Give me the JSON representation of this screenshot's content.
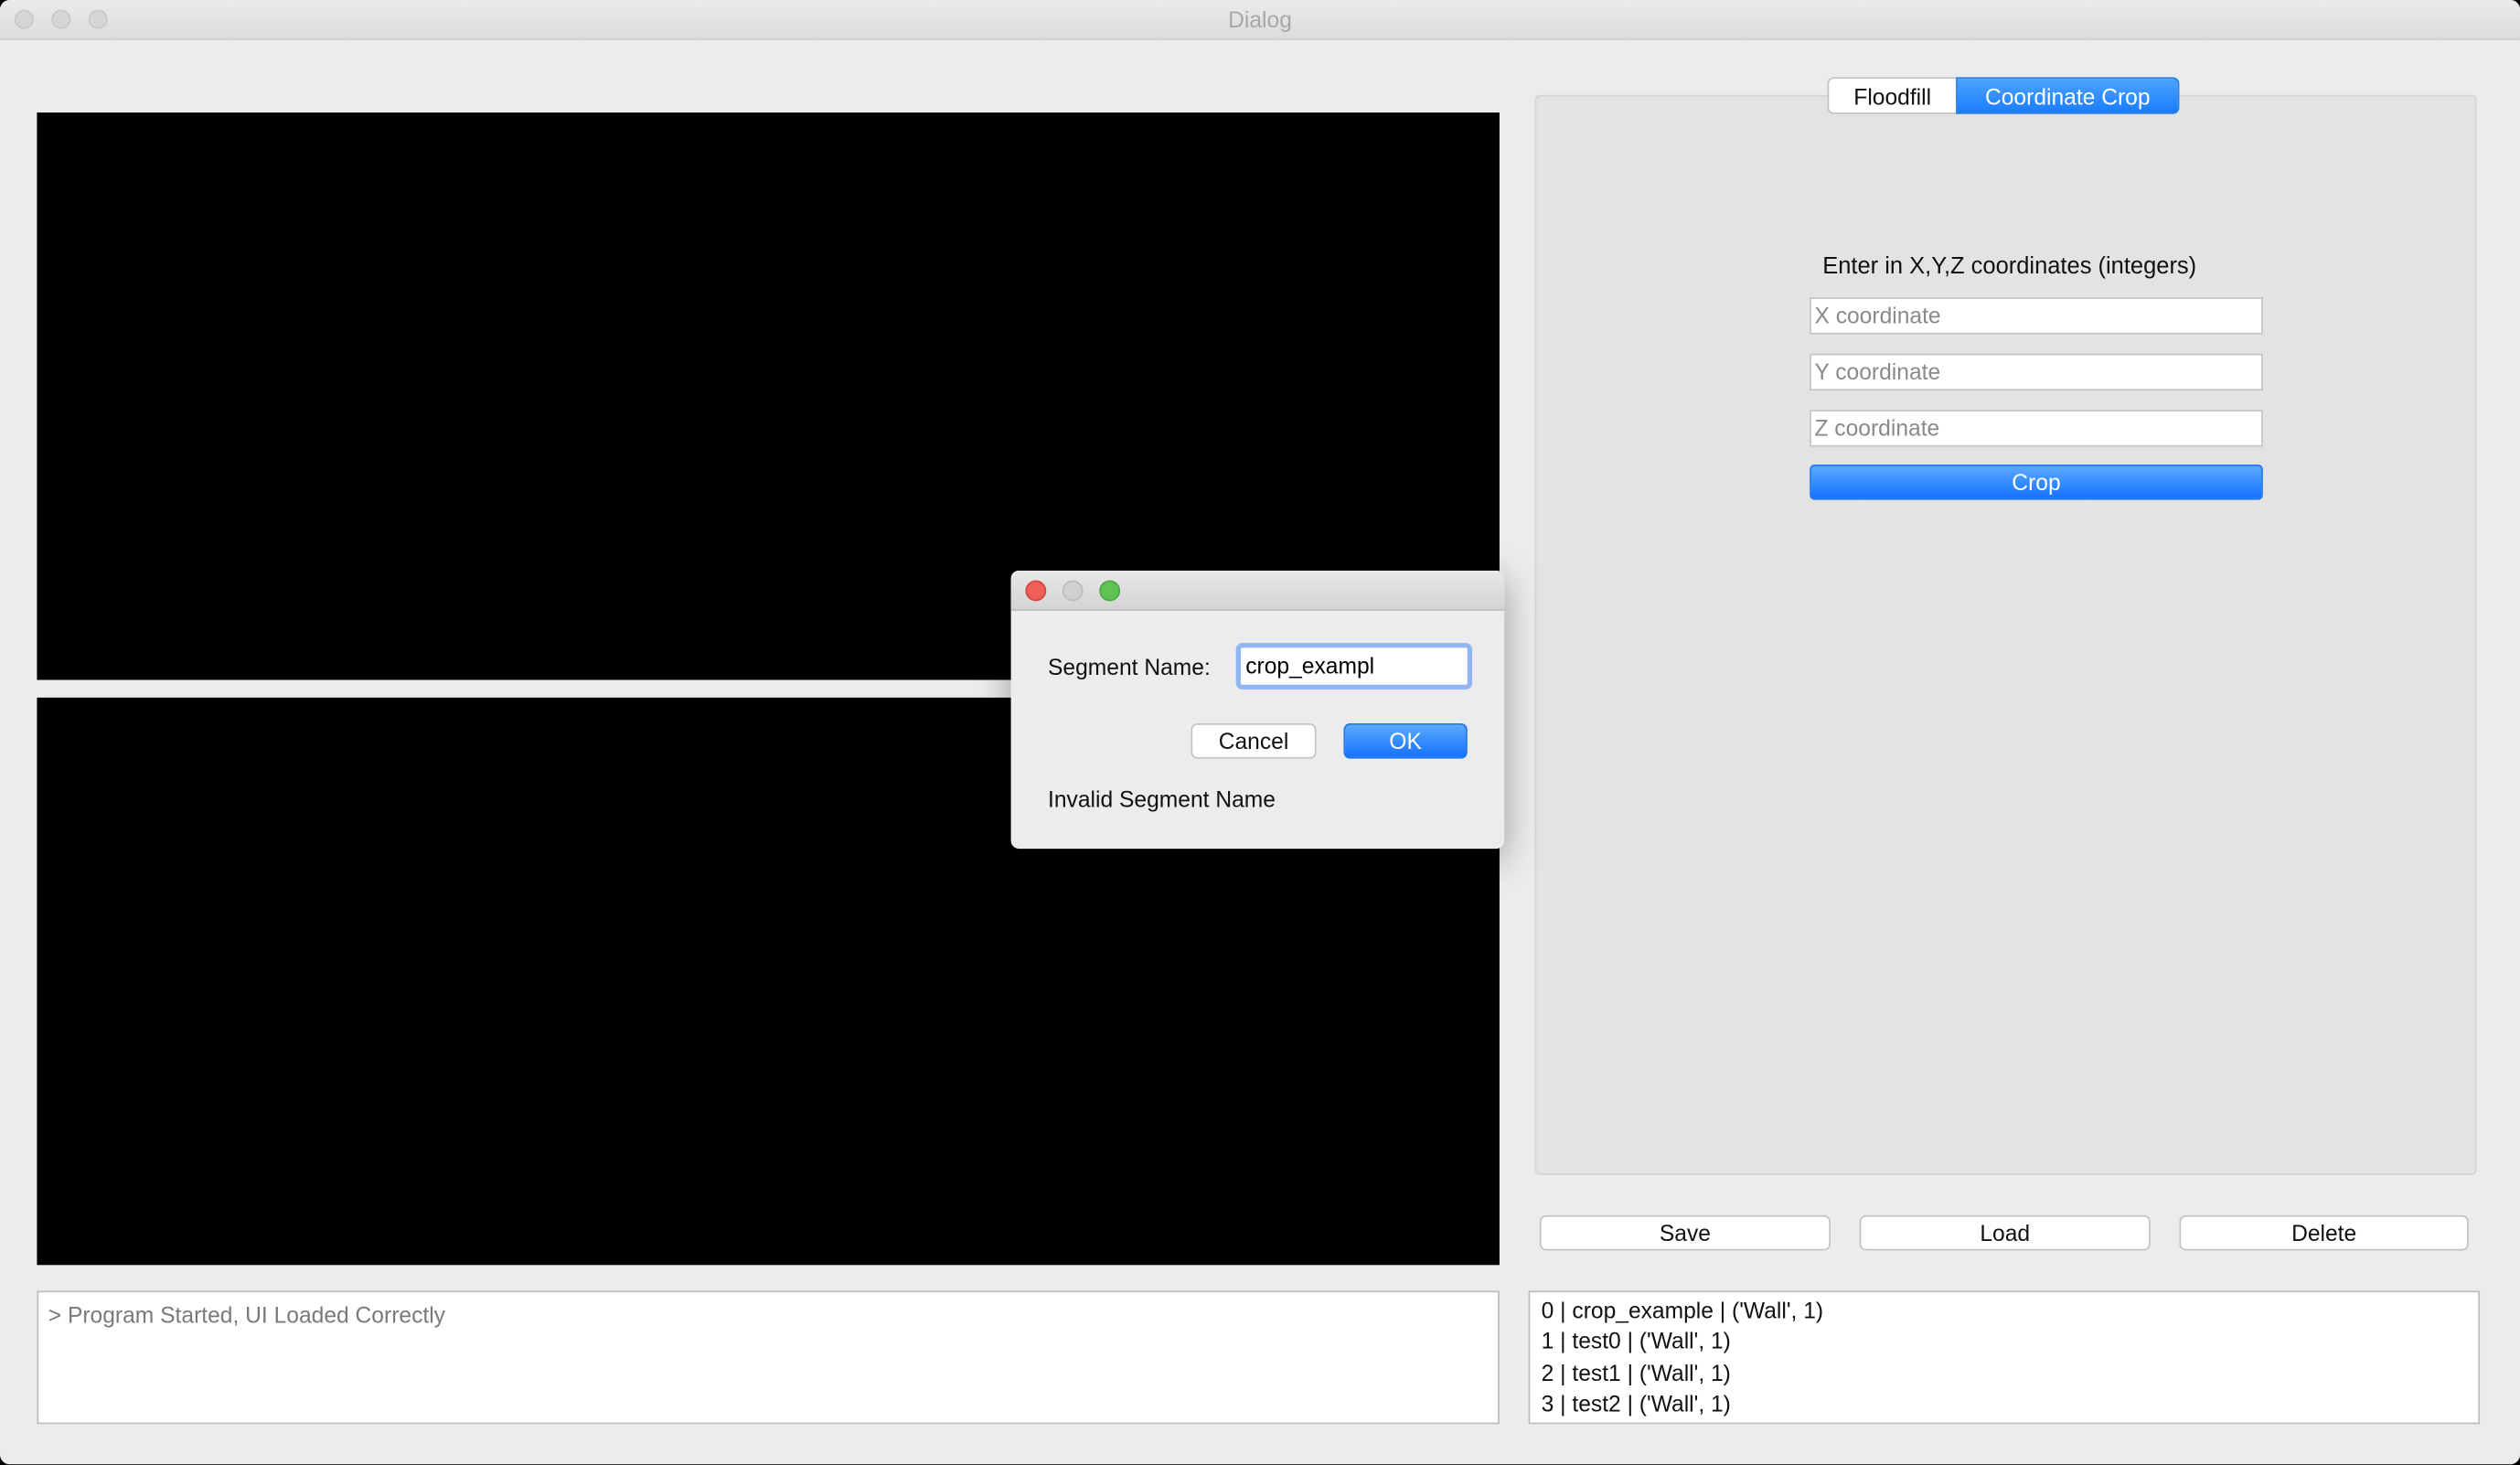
{
  "window": {
    "title": "Dialog"
  },
  "log": {
    "text": "> Program Started, UI Loaded Correctly"
  },
  "tabs": [
    {
      "label": "Floodfill",
      "active": false
    },
    {
      "label": "Coordinate Crop",
      "active": true
    }
  ],
  "crop": {
    "instructions": "Enter in X,Y,Z coordinates (integers)",
    "x_placeholder": "X coordinate",
    "y_placeholder": "Y coordinate",
    "z_placeholder": "Z coordinate",
    "crop_label": "Crop"
  },
  "actions": {
    "save": "Save",
    "load": "Load",
    "delete": "Delete"
  },
  "segments": [
    "0 | crop_example | ('Wall', 1)",
    "1 | test0 | ('Wall', 1)",
    "2 | test1 | ('Wall', 1)",
    "3 | test2 | ('Wall', 1)"
  ],
  "modal": {
    "label": "Segment Name:",
    "value": "crop_exampl",
    "cancel": "Cancel",
    "ok": "OK",
    "error": "Invalid Segment Name"
  },
  "colors": {
    "accent": "#1a7dff",
    "close": "#ee5f57",
    "zoom": "#5fc454"
  }
}
